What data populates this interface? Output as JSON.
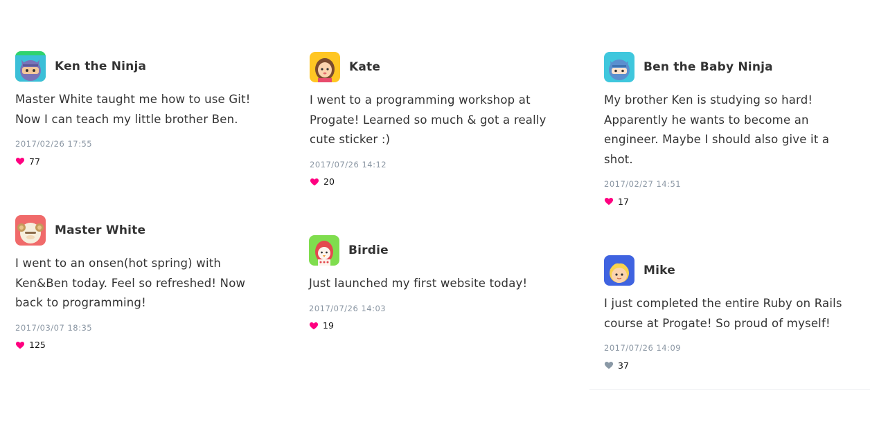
{
  "posts": [
    {
      "user": "Ken the Ninja",
      "text": "Master White taught me how to use Git! Now I can teach my little brother Ben.",
      "time": "2017/02/26 17:55",
      "likes": "77",
      "liked": true,
      "avatar": "ken-ninja-avatar"
    },
    {
      "user": "Master White",
      "text": "I went to an onsen(hot spring) with Ken&Ben today. Feel so refreshed! Now back to programming!",
      "time": "2017/03/07 18:35",
      "likes": "125",
      "liked": true,
      "avatar": "master-white-avatar"
    },
    {
      "user": "Kate",
      "text": "I went to a programming workshop at Progate! Learned so much & got a really cute sticker :)",
      "time": "2017/07/26 14:12",
      "likes": "20",
      "liked": true,
      "avatar": "kate-avatar"
    },
    {
      "user": "Birdie",
      "text": "Just launched my first website today!",
      "time": "2017/07/26 14:03",
      "likes": "19",
      "liked": true,
      "avatar": "birdie-avatar"
    },
    {
      "user": "Ben the Baby Ninja",
      "text": "My brother Ken is studying so hard! Apparently he wants to become an engineer. Maybe I should also give it a shot.",
      "time": "2017/02/27 14:51",
      "likes": "17",
      "liked": true,
      "avatar": "ben-baby-ninja-avatar"
    },
    {
      "user": "Mike",
      "text": "I just completed the entire Ruby on Rails course at Progate! So proud of myself!",
      "time": "2017/07/26 14:09",
      "likes": "37",
      "liked": false,
      "avatar": "mike-avatar"
    }
  ],
  "colors": {
    "liked": "#ff0080",
    "unliked": "#8a99a6",
    "timestamp": "#8a96a3"
  }
}
